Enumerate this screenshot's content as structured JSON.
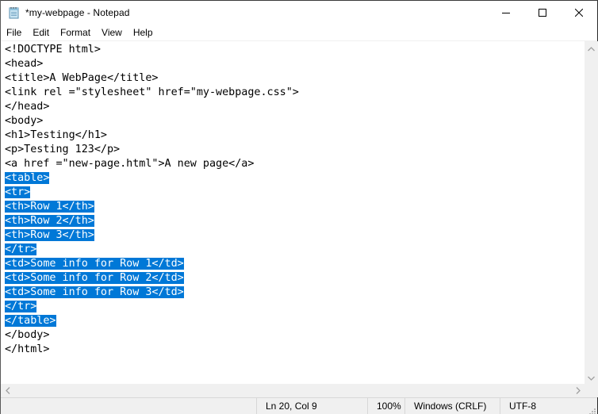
{
  "window": {
    "title": "*my-webpage - Notepad",
    "app_icon": "notepad-icon",
    "controls": [
      "minimize-icon",
      "maximize-icon",
      "close-icon"
    ]
  },
  "menu": {
    "items": [
      {
        "label": "File"
      },
      {
        "label": "Edit"
      },
      {
        "label": "Format"
      },
      {
        "label": "View"
      },
      {
        "label": "Help"
      }
    ]
  },
  "editor": {
    "selection_color": "#0078d7",
    "lines": [
      {
        "text": "<!DOCTYPE html>",
        "selected": false
      },
      {
        "text": "<head>",
        "selected": false
      },
      {
        "text": "<title>A WebPage</title>",
        "selected": false
      },
      {
        "text": "<link rel =\"stylesheet\" href=\"my-webpage.css\">",
        "selected": false
      },
      {
        "text": "</head>",
        "selected": false
      },
      {
        "text": "<body>",
        "selected": false
      },
      {
        "text": "<h1>Testing</h1>",
        "selected": false
      },
      {
        "text": "<p>Testing 123</p>",
        "selected": false
      },
      {
        "text": "<a href =\"new-page.html\">A new page</a>",
        "selected": false
      },
      {
        "text": "<table>",
        "selected": true
      },
      {
        "text": "<tr>",
        "selected": true
      },
      {
        "text": "<th>Row 1</th>",
        "selected": true
      },
      {
        "text": "<th>Row 2</th>",
        "selected": true
      },
      {
        "text": "<th>Row 3</th>",
        "selected": true
      },
      {
        "text": "</tr>",
        "selected": true
      },
      {
        "text": "<td>Some info for Row 1</td>",
        "selected": true
      },
      {
        "text": "<td>Some info for Row 2</td>",
        "selected": true
      },
      {
        "text": "<td>Some info for Row 3</td>",
        "selected": true
      },
      {
        "text": "</tr>",
        "selected": true
      },
      {
        "text": "</table>",
        "selected": true
      },
      {
        "text": "</body>",
        "selected": false
      },
      {
        "text": "</html>",
        "selected": false
      }
    ]
  },
  "statusbar": {
    "position": "Ln 20, Col 9",
    "zoom": "100%",
    "line_ending": "Windows (CRLF)",
    "encoding": "UTF-8"
  }
}
